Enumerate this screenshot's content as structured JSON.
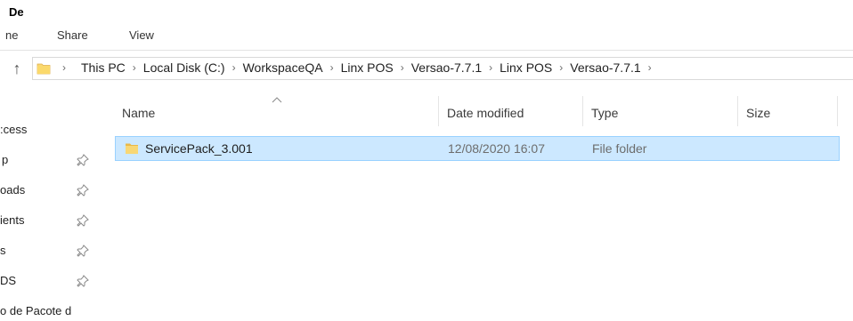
{
  "window": {
    "title_fragment": "De"
  },
  "ribbon": {
    "tabs": [
      "ne",
      "Share",
      "View"
    ]
  },
  "address": {
    "crumbs": [
      "This PC",
      "Local Disk (C:)",
      "WorkspaceQA",
      "Linx POS",
      "Versao-7.7.1",
      "Linx POS",
      "Versao-7.7.1"
    ]
  },
  "nav_pane": {
    "items": [
      {
        "label": ":cess",
        "pinned": false
      },
      {
        "label": "p",
        "pinned": true
      },
      {
        "label": "oads",
        "pinned": true
      },
      {
        "label": "ients",
        "pinned": true
      },
      {
        "label": "s",
        "pinned": true
      },
      {
        "label": "DS",
        "pinned": true
      },
      {
        "label": "o de Pacote d",
        "pinned": false
      }
    ]
  },
  "columns": {
    "name": "Name",
    "date": "Date modified",
    "type": "Type",
    "size": "Size"
  },
  "rows": [
    {
      "name": "ServicePack_3.001",
      "date": "12/08/2020 16:07",
      "type": "File folder",
      "size": "",
      "selected": true
    }
  ],
  "colors": {
    "folder": "#f8d775",
    "folder_dark": "#e9b94a",
    "selection_bg": "#cce8ff",
    "selection_border": "#99d1ff"
  }
}
